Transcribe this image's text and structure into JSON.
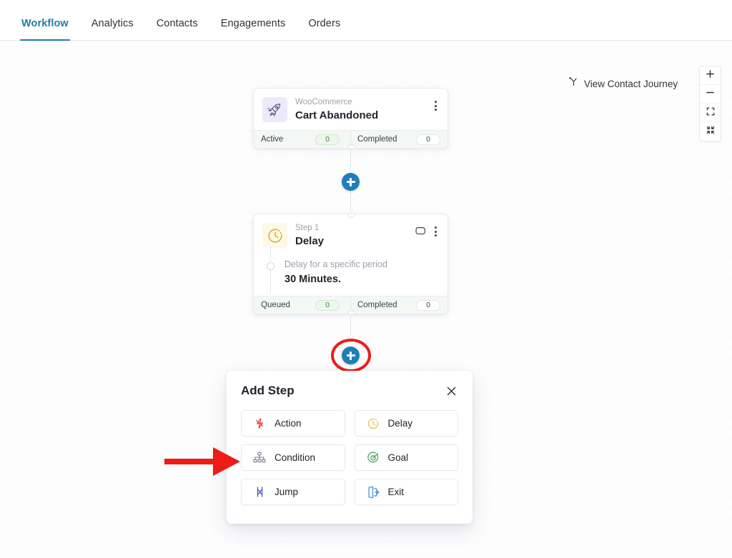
{
  "nav": {
    "tabs": [
      {
        "label": "Workflow",
        "active": true
      },
      {
        "label": "Analytics",
        "active": false
      },
      {
        "label": "Contacts",
        "active": false
      },
      {
        "label": "Engagements",
        "active": false
      },
      {
        "label": "Orders",
        "active": false
      }
    ],
    "active_color": "#1a7fa8"
  },
  "canvas": {
    "journey_button": {
      "label": "View Contact Journey",
      "icon": "branch-icon"
    },
    "zoom_controls": [
      {
        "name": "zoom-in",
        "icon": "plus-icon"
      },
      {
        "name": "zoom-out",
        "icon": "minus-icon"
      },
      {
        "name": "fit-view",
        "icon": "expand-icon"
      },
      {
        "name": "collapse-view",
        "icon": "collapse-icon"
      }
    ]
  },
  "trigger_node": {
    "icon": "rocket-icon",
    "source": "WooCommerce",
    "title": "Cart Abandoned",
    "menu_icon": "kebab-menu-icon",
    "stats": [
      {
        "label": "Active",
        "value": "0",
        "style": "green"
      },
      {
        "label": "Completed",
        "value": "0",
        "style": "white"
      }
    ]
  },
  "delay_node": {
    "icon": "clock-icon",
    "step_label": "Step 1",
    "title": "Delay",
    "comment_icon": "comment-icon",
    "menu_icon": "kebab-menu-icon",
    "body_sub": "Delay for a specific period",
    "body_main": "30 Minutes.",
    "stats": [
      {
        "label": "Queued",
        "value": "0",
        "style": "green"
      },
      {
        "label": "Completed",
        "value": "0",
        "style": "white"
      }
    ]
  },
  "add_buttons": {
    "upper": {
      "name": "add-step-button-upper",
      "icon": "plus-icon"
    },
    "lower": {
      "name": "add-step-button-lower",
      "icon": "plus-icon",
      "highlighted": true
    }
  },
  "add_step_panel": {
    "title": "Add Step",
    "close_icon": "close-icon",
    "options": [
      {
        "label": "Action",
        "icon": "lightning-icon",
        "color": "#e0443a"
      },
      {
        "label": "Delay",
        "icon": "clock-icon",
        "color": "#e5b93c"
      },
      {
        "label": "Condition",
        "icon": "hierarchy-icon",
        "color": "#707a86"
      },
      {
        "label": "Goal",
        "icon": "target-icon",
        "color": "#4ea055"
      },
      {
        "label": "Jump",
        "icon": "jump-icon",
        "color": "#4b4fd0"
      },
      {
        "label": "Exit",
        "icon": "exit-icon",
        "color": "#4a90d9"
      }
    ]
  },
  "annotations": {
    "ring_color": "#ee1b17",
    "arrow_color": "#ee1b17"
  }
}
